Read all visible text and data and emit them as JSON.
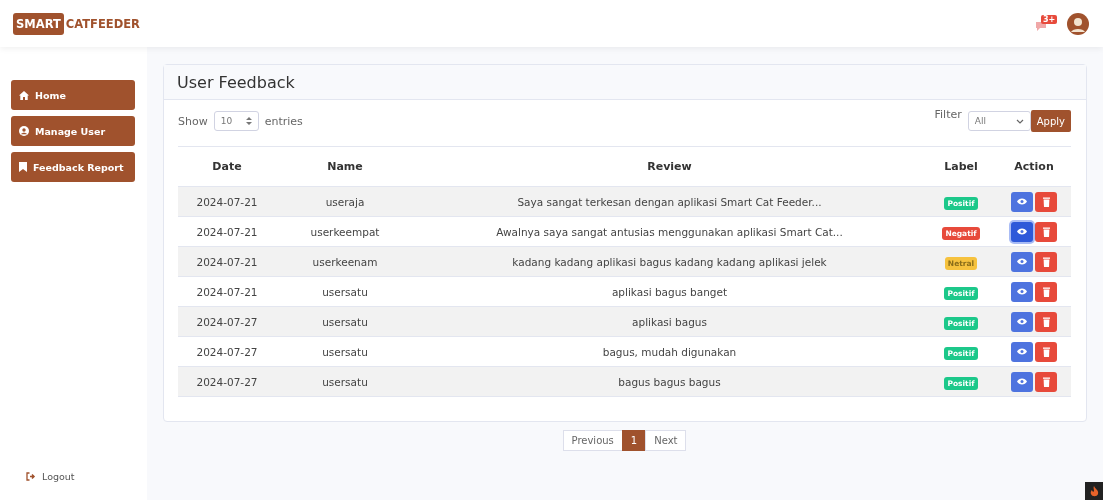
{
  "brand": {
    "highlight": "SMART",
    "rest": "CATFEEDER"
  },
  "header": {
    "notification_count": "3+"
  },
  "sidebar": {
    "items": [
      {
        "label": "Home",
        "kind": "home"
      },
      {
        "label": "Manage User",
        "kind": "user"
      },
      {
        "label": "Feedback Report",
        "kind": "bookmark"
      }
    ],
    "logout": "Logout"
  },
  "card": {
    "title": "User Feedback",
    "length": {
      "before": "Show",
      "value": "10",
      "after": "entries"
    },
    "filter": {
      "label": "Filter",
      "value": "All",
      "button": "Apply"
    },
    "table": {
      "columns": [
        "Date",
        "Name",
        "Review",
        "Label",
        "Action"
      ],
      "rows": [
        {
          "date": "2024-07-21",
          "name": "useraja",
          "review": "Saya sangat terkesan dengan aplikasi Smart Cat Feeder...",
          "label": "Positif",
          "kind": "positive",
          "view_focused": false
        },
        {
          "date": "2024-07-21",
          "name": "userkeempat",
          "review": "Awalnya saya sangat antusias menggunakan aplikasi Smart Cat...",
          "label": "Negatif",
          "kind": "negative",
          "view_focused": true
        },
        {
          "date": "2024-07-21",
          "name": "userkeenam",
          "review": "kadang kadang aplikasi bagus kadang kadang aplikasi jelek",
          "label": "Netral",
          "kind": "neutral",
          "view_focused": false
        },
        {
          "date": "2024-07-21",
          "name": "usersatu",
          "review": "aplikasi bagus banget",
          "label": "Positif",
          "kind": "positive",
          "view_focused": false
        },
        {
          "date": "2024-07-27",
          "name": "usersatu",
          "review": "aplikasi bagus",
          "label": "Positif",
          "kind": "positive",
          "view_focused": false
        },
        {
          "date": "2024-07-27",
          "name": "usersatu",
          "review": "bagus, mudah digunakan",
          "label": "Positif",
          "kind": "positive",
          "view_focused": false
        },
        {
          "date": "2024-07-27",
          "name": "usersatu",
          "review": "bagus bagus bagus",
          "label": "Positif",
          "kind": "positive",
          "view_focused": false
        }
      ]
    }
  },
  "pagination": {
    "previous": "Previous",
    "pages": [
      {
        "label": "1",
        "selected": true
      }
    ],
    "next": "Next"
  }
}
